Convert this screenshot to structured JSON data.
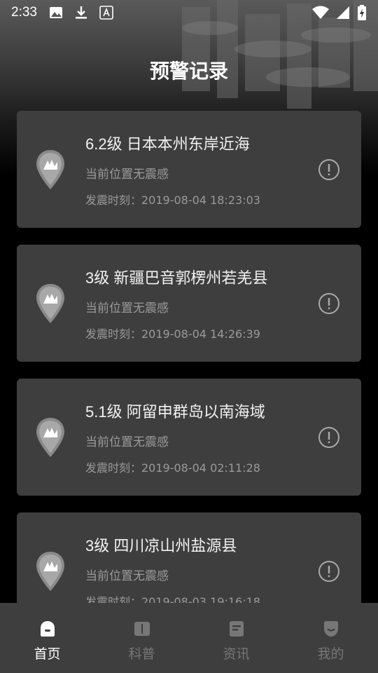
{
  "status_bar": {
    "time": "2:33",
    "icons": [
      "image-icon",
      "download-icon",
      "text-a-icon"
    ],
    "right_icons": [
      "wifi-icon",
      "signal-icon",
      "battery-icon"
    ]
  },
  "header": {
    "title": "预警记录"
  },
  "records": [
    {
      "magnitude_location": "6.2级 日本本州东岸近海",
      "felt": "当前位置无震感",
      "time": "发震时刻：2019-08-04 18:23:03"
    },
    {
      "magnitude_location": "3级 新疆巴音郭楞州若羌县",
      "felt": "当前位置无震感",
      "time": "发震时刻：2019-08-04 14:26:39"
    },
    {
      "magnitude_location": "5.1级 阿留申群岛以南海域",
      "felt": "当前位置无震感",
      "time": "发震时刻：2019-08-04 02:11:28"
    },
    {
      "magnitude_location": "3级 四川凉山州盐源县",
      "felt": "当前位置无震感",
      "time": "发震时刻：2019-08-03 19:16:18"
    }
  ],
  "tabs": [
    {
      "label": "首页",
      "icon": "home-icon",
      "active": true
    },
    {
      "label": "科普",
      "icon": "book-icon",
      "active": false
    },
    {
      "label": "资讯",
      "icon": "news-icon",
      "active": false
    },
    {
      "label": "我的",
      "icon": "profile-icon",
      "active": false
    }
  ],
  "colors": {
    "card": "#3e3e3e",
    "tabbar": "#3e3e3e",
    "muted_text": "#9a9a9a",
    "inactive_tab": "#777777"
  }
}
